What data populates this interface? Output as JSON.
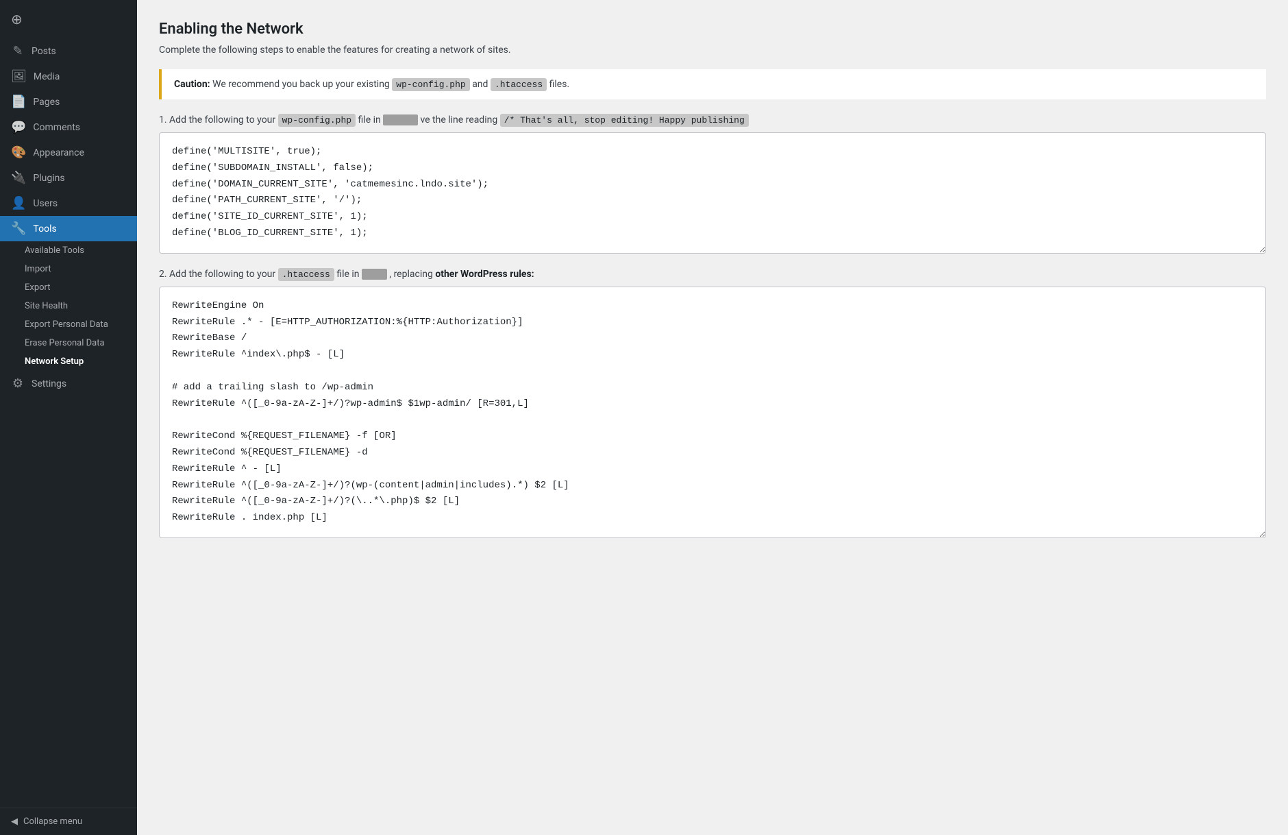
{
  "sidebar": {
    "items": [
      {
        "id": "posts",
        "label": "Posts",
        "icon": "✎"
      },
      {
        "id": "media",
        "label": "Media",
        "icon": "🖼"
      },
      {
        "id": "pages",
        "label": "Pages",
        "icon": "📄"
      },
      {
        "id": "comments",
        "label": "Comments",
        "icon": "💬"
      },
      {
        "id": "appearance",
        "label": "Appearance",
        "icon": "🎨"
      },
      {
        "id": "plugins",
        "label": "Plugins",
        "icon": "🔌"
      },
      {
        "id": "users",
        "label": "Users",
        "icon": "👤"
      },
      {
        "id": "tools",
        "label": "Tools",
        "icon": "🔧",
        "active": true
      }
    ],
    "tools_submenu": [
      {
        "id": "available-tools",
        "label": "Available Tools"
      },
      {
        "id": "import",
        "label": "Import"
      },
      {
        "id": "export",
        "label": "Export"
      },
      {
        "id": "site-health",
        "label": "Site Health"
      },
      {
        "id": "export-personal-data",
        "label": "Export Personal Data"
      },
      {
        "id": "erase-personal-data",
        "label": "Erase Personal Data"
      },
      {
        "id": "network-setup",
        "label": "Network Setup",
        "active": true
      }
    ],
    "bottom_items": [
      {
        "id": "settings",
        "label": "Settings",
        "icon": "⚙"
      }
    ],
    "collapse_label": "Collapse menu"
  },
  "main": {
    "title": "Enabling the Network",
    "subtitle": "Complete the following steps to enable the features for creating a network of sites.",
    "caution": {
      "label": "Caution:",
      "text": "We recommend you back up your existing",
      "file1": "wp-config.php",
      "middle": "and",
      "file2": ".htaccess",
      "end": "files."
    },
    "step1": {
      "number": "1.",
      "text_before": "Add the following to your",
      "code": "wp-config.php",
      "text_mid": "file in",
      "redacted": "                ",
      "text_after": "ve the line reading",
      "comment": "/* That's all, stop editing! Happy publishing"
    },
    "code_block1": "define('MULTISITE', true);\ndefine('SUBDOMAIN_INSTALL', false);\ndefine('DOMAIN_CURRENT_SITE', 'catmemesinc.lndo.site');\ndefine('PATH_CURRENT_SITE', '/');\ndefine('SITE_ID_CURRENT_SITE', 1);\ndefine('BLOG_ID_CURRENT_SITE', 1);",
    "step2": {
      "number": "2.",
      "text_before": "Add the following to your",
      "code": ".htaccess",
      "text_mid": "file in",
      "redacted": "        ",
      "text_after": ", replacing",
      "bold": "other WordPress rules:"
    },
    "code_block2": "RewriteEngine On\nRewriteRule .* - [E=HTTP_AUTHORIZATION:%{HTTP:Authorization}]\nRewriteBase /\nRewriteRule ^index\\.php$ - [L]\n\n# add a trailing slash to /wp-admin\nRewriteRule ^([_0-9a-zA-Z-]+/)?wp-admin$ $1wp-admin/ [R=301,L]\n\nRewriteCond %{REQUEST_FILENAME} -f [OR]\nRewriteCond %{REQUEST_FILENAME} -d\nRewriteRule ^ - [L]\nRewriteRule ^([_0-9a-zA-Z-]+/)?(wp-(content|admin|includes).*) $2 [L]\nRewriteRule ^([_0-9a-zA-Z-]+/)?(\\..*\\.php)$ $2 [L]\nRewriteRule . index.php [L]"
  }
}
